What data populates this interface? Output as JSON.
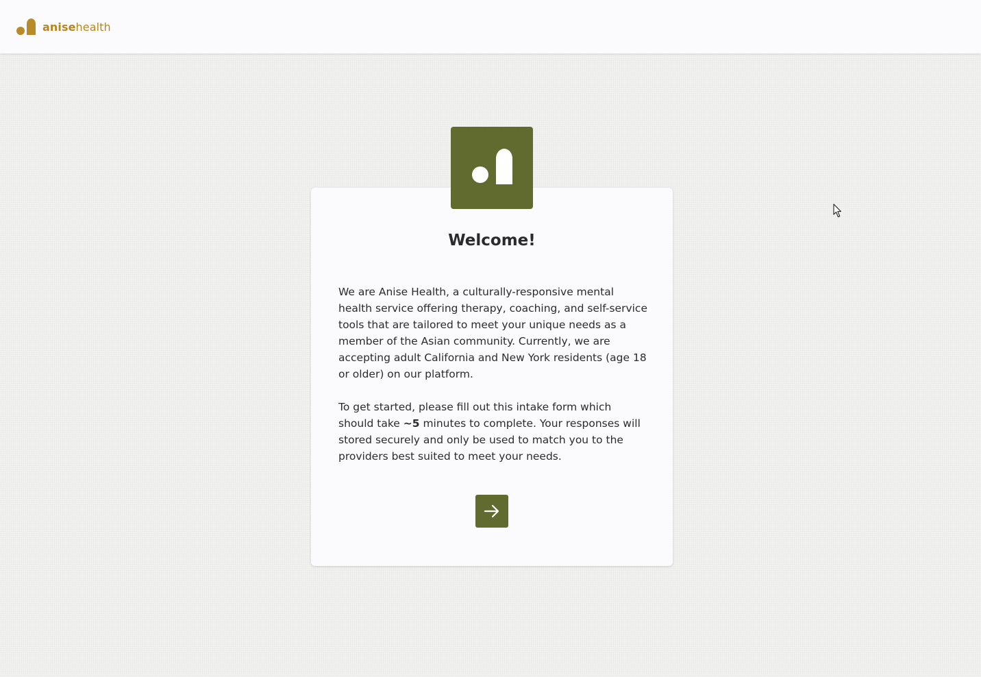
{
  "header": {
    "brand_part1": "anise",
    "brand_part2": "health",
    "brand_color": "#b5861f"
  },
  "welcome": {
    "title": "Welcome!",
    "intro": "We are Anise Health, a culturally-responsive mental health service offering therapy, coaching, and self-service tools that are tailored to meet your unique needs as a member of the Asian community. Currently, we are accepting adult California and New York residents (age 18 or older) on our platform.",
    "instructions_before": "To get started, please fill out this intake form which should take ",
    "instructions_bold": "~5",
    "instructions_after": " minutes to complete. Your responses will stored securely and only be used to match you to the providers best suited to meet your needs.",
    "next_icon": "arrow-right-icon",
    "accent_color": "#626b2f"
  }
}
